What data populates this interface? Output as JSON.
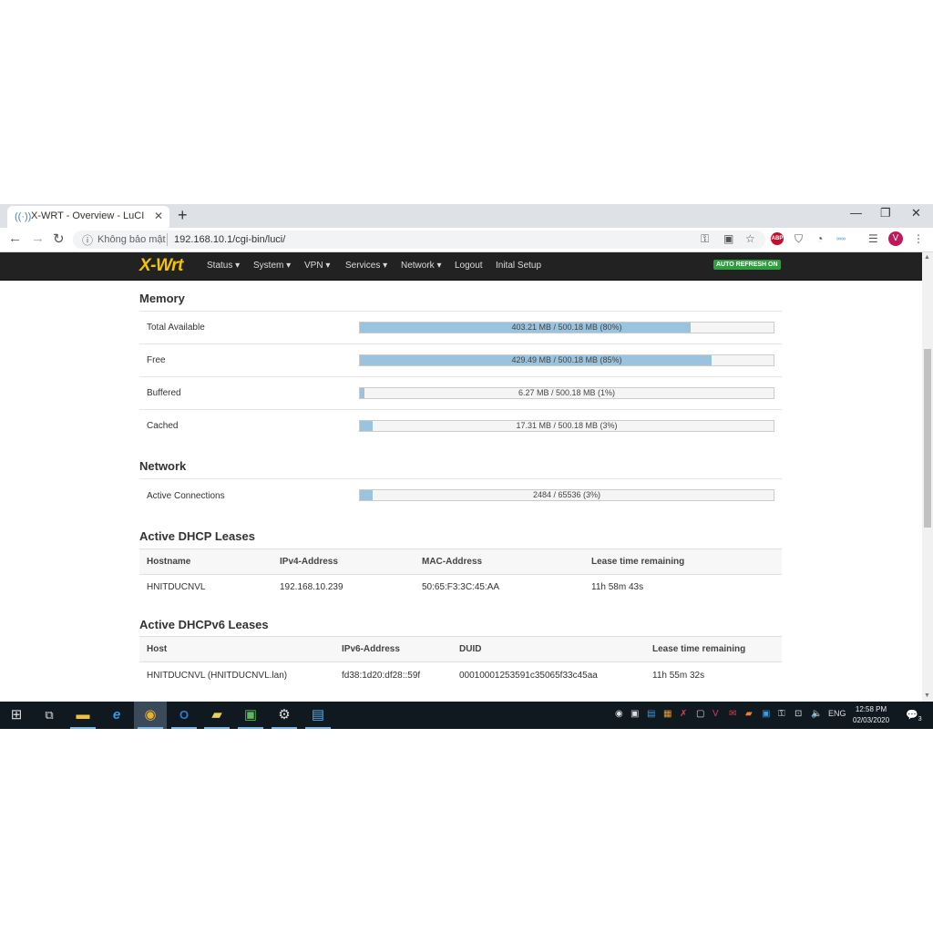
{
  "browser": {
    "tab_title": "X-WRT - Overview - LuCI",
    "new_tab": "+",
    "address_insecure": "Không bảo mật",
    "url": "192.168.10.1/cgi-bin/luci/",
    "avatar_letter": "V",
    "abp_label": "ABP"
  },
  "router": {
    "brand": "X-Wrt",
    "menu": [
      "Status ▾",
      "System ▾",
      "VPN ▾",
      "Services ▾",
      "Network ▾",
      "Logout",
      "Inital Setup"
    ],
    "auto_refresh": "AUTO REFRESH ON"
  },
  "memory": {
    "title": "Memory",
    "rows": [
      {
        "label": "Total Available",
        "text": "403.21 MB / 500.18 MB (80%)",
        "fraction": 0.8
      },
      {
        "label": "Free",
        "text": "429.49 MB / 500.18 MB (85%)",
        "fraction": 0.85
      },
      {
        "label": "Buffered",
        "text": "6.27 MB / 500.18 MB (1%)",
        "fraction": 0.01
      },
      {
        "label": "Cached",
        "text": "17.31 MB / 500.18 MB (3%)",
        "fraction": 0.03
      }
    ]
  },
  "network": {
    "title": "Network",
    "rows": [
      {
        "label": "Active Connections",
        "text": "2484 / 65536 (3%)",
        "fraction": 0.03
      }
    ]
  },
  "dhcp": {
    "title": "Active DHCP Leases",
    "headers": [
      "Hostname",
      "IPv4-Address",
      "MAC-Address",
      "Lease time remaining"
    ],
    "rows": [
      [
        "HNITDUCNVL",
        "192.168.10.239",
        "50:65:F3:3C:45:AA",
        "11h 58m 43s"
      ]
    ]
  },
  "dhcp6": {
    "title": "Active DHCPv6 Leases",
    "headers": [
      "Host",
      "IPv6-Address",
      "DUID",
      "Lease time remaining"
    ],
    "rows": [
      [
        "HNITDUCNVL (HNITDUCNVL.lan)",
        "fd38:1d20:df28::59f",
        "00010001253591c35065f33c45aa",
        "11h 55m 32s"
      ]
    ]
  },
  "taskbar": {
    "language": "ENG",
    "time": "12:58 PM",
    "date": "02/03/2020",
    "notifications": "3"
  },
  "colors": {
    "bar_fill": "#9ac3e0",
    "navbar": "#222222",
    "brand": "#f5c400",
    "auto_refresh": "#2e9e41",
    "taskbar": "#101820"
  }
}
